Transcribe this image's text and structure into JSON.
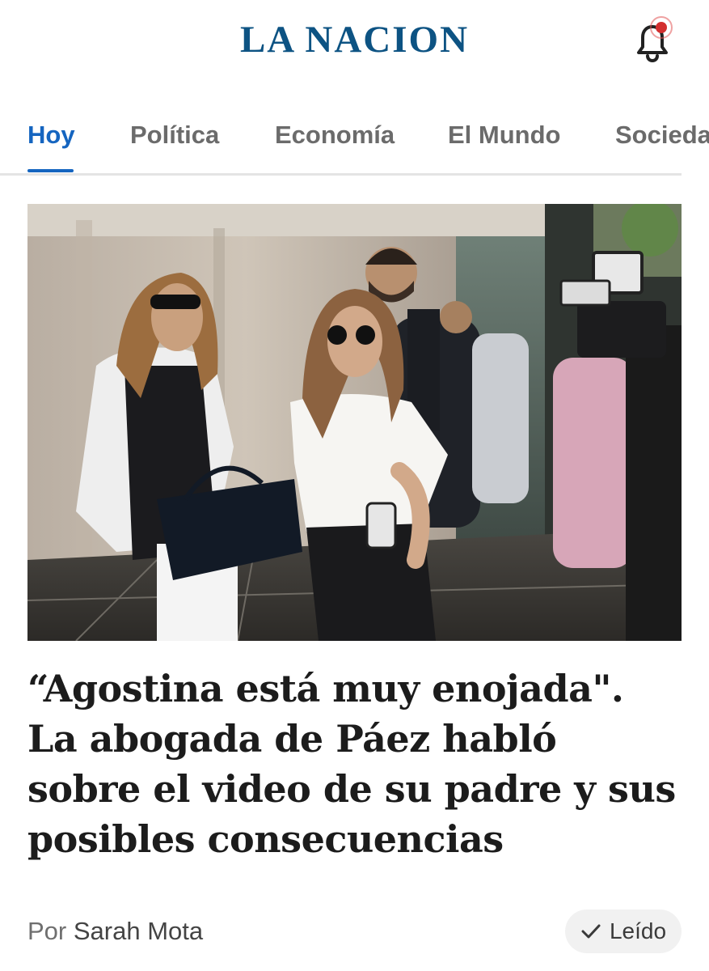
{
  "header": {
    "logo": "LA NACION",
    "notification_icon": "bell-icon",
    "notification_dot_color": "#d32f2f"
  },
  "nav": {
    "tabs": [
      {
        "label": "Hoy",
        "active": true
      },
      {
        "label": "Política",
        "active": false
      },
      {
        "label": "Economía",
        "active": false
      },
      {
        "label": "El Mundo",
        "active": false
      },
      {
        "label": "Sociedad",
        "active": false
      }
    ],
    "active_color": "#1565c0"
  },
  "article": {
    "headline": "“Agostina está muy enojada\". La abogada de Páez habló sobre el video de su padre y sus posibles consecuencias",
    "byline_prefix": "Por",
    "author": "Sarah Mota",
    "read_badge": {
      "icon": "check-icon",
      "label": "Leído"
    }
  },
  "colors": {
    "brand": "#0d5383",
    "accent": "#1565c0",
    "headline_text": "#1c1c1c"
  }
}
